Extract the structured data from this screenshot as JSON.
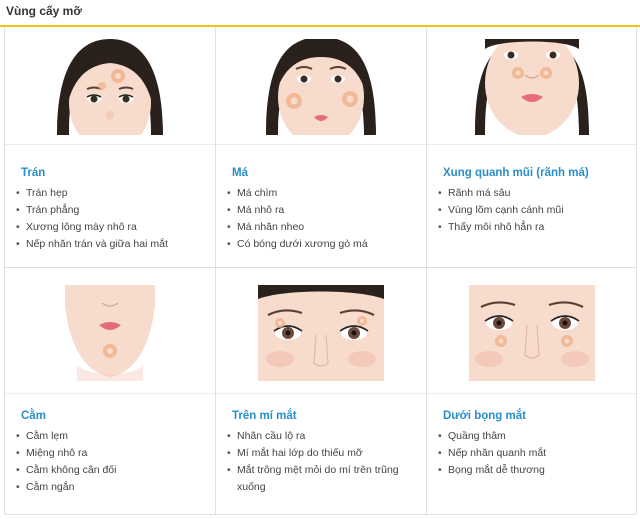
{
  "page": {
    "title": "Vùng cấy mỡ"
  },
  "regions": [
    {
      "title": "Trán",
      "items": [
        "Trán hẹp",
        "Trán phẳng",
        "Xương lông mày nhô ra",
        "Nếp nhăn trán và giữa hai mắt"
      ]
    },
    {
      "title": "Má",
      "items": [
        "Má chìm",
        "Má nhô ra",
        "Má nhăn nheo",
        "Có bóng dưới xương gò má"
      ]
    },
    {
      "title": "Xung quanh mũi (rãnh má)",
      "items": [
        "Rãnh má sâu",
        "Vùng lõm cạnh cánh mũi",
        "Thấy môi nhô hẳn ra"
      ]
    },
    {
      "title": "Cằm",
      "items": [
        "Cằm lẹm",
        "Miệng nhô ra",
        "Cằm không cân đối",
        "Cằm ngắn"
      ]
    },
    {
      "title": "Trên mí mắt",
      "items": [
        "Nhãn cầu lộ ra",
        "Mí mắt hai lớp do thiếu mỡ",
        "Mắt trông mệt mỏi do mí trên trũng xuống"
      ]
    },
    {
      "title": "Dưới bọng mắt",
      "items": [
        "Quầng thâm",
        "Nếp nhăn quanh mắt",
        "Bọng mắt dễ thương"
      ]
    }
  ],
  "illustrations": [
    {
      "icon": "forehead-face-illustration"
    },
    {
      "icon": "cheek-face-illustration"
    },
    {
      "icon": "nose-area-face-illustration"
    },
    {
      "icon": "chin-face-illustration"
    },
    {
      "icon": "upper-eyelid-face-illustration"
    },
    {
      "icon": "under-eye-face-illustration"
    }
  ],
  "colors": {
    "accent_rule": "#f2c21a",
    "heading": "#2a8fc9",
    "fat_marker": "#e8a47c"
  }
}
